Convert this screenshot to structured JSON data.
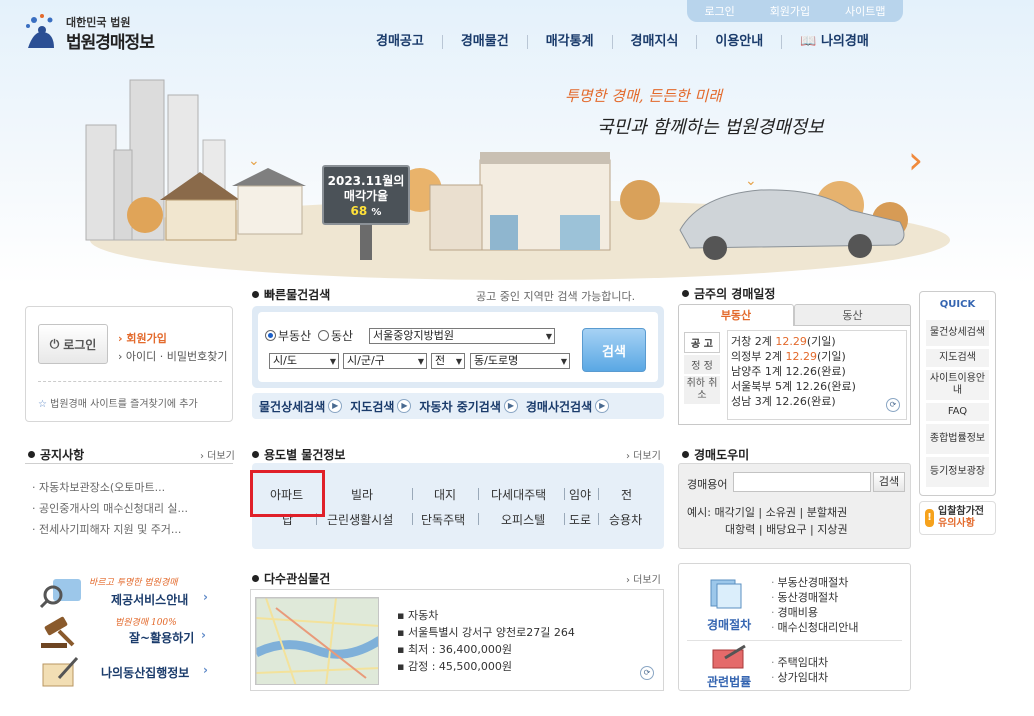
{
  "top_links": [
    "로그인",
    "회원가입",
    "사이트맵"
  ],
  "logo": {
    "small": "대한민국 법원",
    "main": "법원경매정보"
  },
  "nav": [
    "경매공고",
    "경매물건",
    "매각통계",
    "경매지식",
    "이용안내",
    "나의경매"
  ],
  "hero": {
    "slogan1": "투명한 경매, 든든한 미래",
    "slogan2": "국민과 함께하는 법원경매정보",
    "billboard_line1": "2023.11월의",
    "billboard_line2": "매각가율",
    "billboard_rate": "68",
    "billboard_unit": "%"
  },
  "login": {
    "button": "로그인",
    "join": "회원가입",
    "find": "아이디 · 비밀번호찾기",
    "favorite": "법원경매 사이트를 즐겨찾기에 추가"
  },
  "quick_search": {
    "title": "빠른물건검색",
    "hint": "공고 중인 지역만 검색 가능합니다.",
    "radio_realestate": "부동산",
    "radio_movable": "동산",
    "court": "서울중앙지방법원",
    "sido": "시/도",
    "sigungu": "시/군/구",
    "all": "전",
    "dong": "동/도로명",
    "search_button": "검색",
    "links": [
      "물건상세검색",
      "지도검색",
      "자동차 중기검색",
      "경매사건검색"
    ]
  },
  "schedule": {
    "title": "금주의 경매일정",
    "tab_realestate": "부동산",
    "tab_movable": "동산",
    "side": [
      "공 고",
      "정 정",
      "취하 취소"
    ],
    "rows": [
      {
        "court": "거창 2계",
        "date": "12.29",
        "state": "(기일)",
        "hi": true
      },
      {
        "court": "의정부 2계",
        "date": "12.29",
        "state": "(기일)",
        "hi": true
      },
      {
        "court": "남양주 1계",
        "date": "12.26",
        "state": "(완료)",
        "hi": false
      },
      {
        "court": "서울북부 5계",
        "date": "12.26",
        "state": "(완료)",
        "hi": false
      },
      {
        "court": "성남 3계",
        "date": "12.26",
        "state": "(완료)",
        "hi": false
      }
    ]
  },
  "quick_menu": {
    "title": "QUICK",
    "items": [
      "물건상세검색",
      "지도검색",
      "사이트이용안내",
      "FAQ",
      "종합법률정보",
      "등기정보광장"
    ]
  },
  "caution": {
    "line1": "입찰참가전",
    "line2": "유의사항"
  },
  "notices": {
    "title": "공지사항",
    "more": "› 더보기",
    "items": [
      "자동차보관장소(오토마트...",
      "공인중개사의 매수신청대리 실...",
      "전세사기피해자 지원 및 주거..."
    ]
  },
  "by_use": {
    "title": "용도별 물건정보",
    "more": "› 더보기",
    "row1": [
      "아파트",
      "빌라",
      "대지",
      "다세대주택",
      "임야",
      "전"
    ],
    "row2": [
      "답",
      "근린생활시설",
      "단독주택",
      "오피스텔",
      "도로",
      "승용차"
    ]
  },
  "helper": {
    "title": "경매도우미",
    "label": "경매용어",
    "input_value": "",
    "button": "검색",
    "terms_prefix": "예시:",
    "terms": [
      "매각기일",
      "소유권",
      "분할채권",
      "대항력",
      "배당요구",
      "지상권"
    ]
  },
  "promos": [
    {
      "small": "바르고 투명한 법원경매",
      "main": "제공서비스안내"
    },
    {
      "small": "법원경매 100%",
      "main": "잘~활용하기"
    },
    {
      "small": "",
      "main": "나의동산집행정보"
    }
  ],
  "multi": {
    "title": "다수관심물건",
    "more": "› 더보기",
    "type": "자동차",
    "address": "서울특별시 강서구 양천로27길 264",
    "min": "최저 : 36,400,000원",
    "appraisal": "감정 : 45,500,000원"
  },
  "procedures": {
    "head1": "경매절차",
    "links1": [
      "부동산경매절차",
      "동산경매절차",
      "경매비용",
      "매수신청대리안내"
    ],
    "head2": "관련법률",
    "links2": [
      "주택임대차",
      "상가임대차"
    ]
  },
  "colors": {
    "accent": "#e36a2c",
    "navy": "#1a3b6b",
    "highlight": "#e02029",
    "blue": "#3565b1"
  }
}
